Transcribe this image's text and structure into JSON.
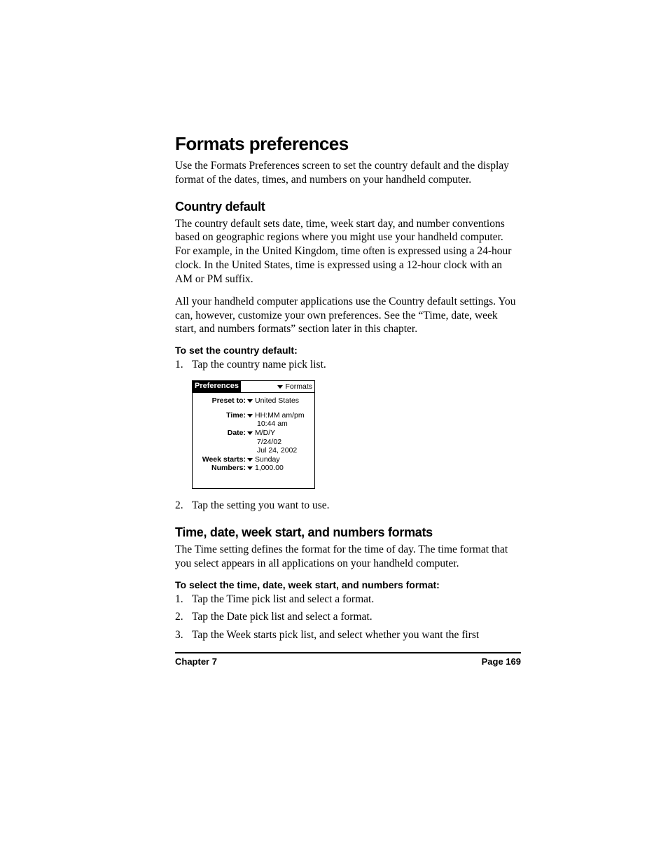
{
  "h1": "Formats preferences",
  "intro": "Use the Formats Preferences screen to set the country default and the display format of the dates, times, and numbers on your handheld computer.",
  "sec1": {
    "title": "Country default",
    "p1": "The country default sets date, time, week start day, and number conventions based on geographic regions where you might use your handheld computer. For example, in the United Kingdom, time often is expressed using a 24-hour clock. In the United States, time is expressed using a 12-hour clock with an AM or PM suffix.",
    "p2": "All your handheld computer applications use the Country default settings. You can, however, customize your own preferences. See the “Time, date, week start, and numbers formats” section later in this chapter.",
    "task_head": "To set the country default:",
    "steps": [
      "Tap the country name pick list.",
      "Tap the setting you want to use."
    ]
  },
  "palm": {
    "title_tab": "Preferences",
    "menu": "Formats",
    "preset_label": "Preset to:",
    "preset_value": "United States",
    "time_label": "Time:",
    "time_value": "HH:MM am/pm",
    "time_example": "10:44 am",
    "date_label": "Date:",
    "date_value": "M/D/Y",
    "date_ex1": "7/24/02",
    "date_ex2": "Jul 24, 2002",
    "week_label": "Week starts:",
    "week_value": "Sunday",
    "num_label": "Numbers:",
    "num_value": "1,000.00"
  },
  "sec2": {
    "title": "Time, date, week start, and numbers formats",
    "p1": "The Time setting defines the format for the time of day. The time format that you select appears in all applications on your handheld computer.",
    "task_head": "To select the time, date, week start, and numbers format:",
    "steps": [
      "Tap the Time pick list and select a format.",
      "Tap the Date pick list and select a format.",
      "Tap the Week starts pick list, and select whether you want the first"
    ]
  },
  "footer": {
    "left": "Chapter 7",
    "right": "Page 169"
  }
}
